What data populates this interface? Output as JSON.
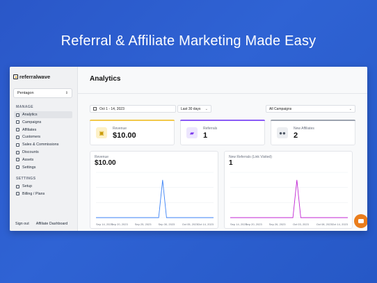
{
  "hero": {
    "title": "Referral & Affiliate Marketing Made Easy"
  },
  "colors": {
    "background": "#2f5fd0",
    "revenue_accent": "#f2c94c",
    "referrals_accent": "#8b5cf6",
    "affiliates_accent": "#6b7280",
    "revenue_line": "#3b82f6",
    "referrals_line": "#c026d3",
    "chat": "#ea7d1c"
  },
  "sidebar": {
    "logo": "referralwave",
    "workspace": "Pentagon",
    "manage_label": "MANAGE",
    "manage_items": [
      {
        "label": "Analytics",
        "icon": "chart-icon"
      },
      {
        "label": "Campaigns",
        "icon": "megaphone-icon"
      },
      {
        "label": "Affiliates",
        "icon": "users-icon"
      },
      {
        "label": "Customers",
        "icon": "user-icon"
      },
      {
        "label": "Sales & Commissions",
        "icon": "dollar-icon"
      },
      {
        "label": "Discounts",
        "icon": "tag-icon"
      },
      {
        "label": "Assets",
        "icon": "folder-icon"
      },
      {
        "label": "Settings",
        "icon": "gear-icon"
      }
    ],
    "settings_label": "SETTINGS",
    "settings_items": [
      {
        "label": "Setup",
        "icon": "wrench-icon"
      },
      {
        "label": "Billing / Plans",
        "icon": "card-icon"
      }
    ],
    "sign_out": "Sign out",
    "affiliate_dashboard": "Affiliate Dashboard"
  },
  "main": {
    "title": "Analytics",
    "date_range": "Oct 1 - 14, 2023",
    "period": "Last 30 days",
    "campaign": "All Campaigns",
    "stats": [
      {
        "label": "Revenue",
        "value": "$10.00"
      },
      {
        "label": "Referrals",
        "value": "1"
      },
      {
        "label": "New Affiliates",
        "value": "2"
      }
    ]
  },
  "chart_data": [
    {
      "type": "line",
      "title": "Revenue",
      "headline": "$10.00",
      "x": [
        "Sep 14, 2023",
        "Sep 20, 2023",
        "Sep 25, 2023",
        "Sep 30, 2023",
        "Oct 05, 2023",
        "Oct 14, 2023"
      ],
      "series": [
        {
          "values": [
            0,
            0,
            0,
            0,
            0,
            0,
            0,
            0,
            0,
            0,
            0,
            0,
            0,
            0,
            0,
            0,
            0,
            10,
            0,
            0,
            0,
            0,
            0,
            0,
            0,
            0,
            0,
            0,
            0,
            0,
            0
          ]
        }
      ],
      "ylim": [
        0,
        12
      ],
      "grid": true
    },
    {
      "type": "line",
      "title": "New Referrals (Link Visited)",
      "headline": "1",
      "x": [
        "Sep 14, 2023",
        "Sep 20, 2023",
        "Sep 26, 2023",
        "Oct 03, 2023",
        "Oct 08, 2023",
        "Oct 14, 2023"
      ],
      "series": [
        {
          "values": [
            0,
            0,
            0,
            0,
            0,
            0,
            0,
            0,
            0,
            0,
            0,
            0,
            0,
            0,
            0,
            0,
            0,
            1,
            0,
            0,
            0,
            0,
            0,
            0,
            0,
            0,
            0,
            0,
            0,
            0,
            0
          ]
        }
      ],
      "ylim": [
        0,
        1.2
      ],
      "grid": true
    }
  ]
}
